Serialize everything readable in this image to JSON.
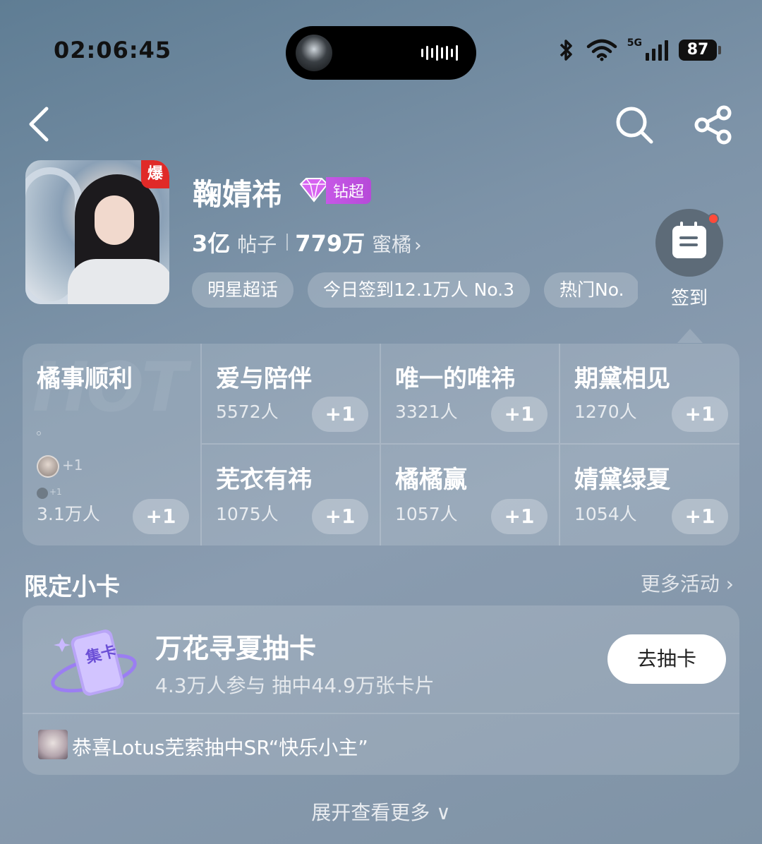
{
  "status_bar": {
    "time": "02:06:45",
    "network": "5G",
    "battery": "87"
  },
  "header": {
    "title": "鞠婧祎",
    "cover_badge": "爆",
    "vip_label": "钻超",
    "stats": [
      {
        "value": "3亿",
        "label": "帖子"
      },
      {
        "value": "779万",
        "label": "蜜橘"
      }
    ],
    "tags": [
      "明星超话",
      "今日签到12.1万人 No.3",
      "热门No."
    ],
    "checkin_label": "签到"
  },
  "grid": {
    "watermark": "HOT",
    "featured": {
      "name": "橘事顺利",
      "count": "3.1万人",
      "plus": "+1",
      "mini_plus": "+1",
      "mini_plus_small": "+1"
    },
    "cells": [
      {
        "name": "爱与陪伴",
        "count": "5572人",
        "plus": "+1"
      },
      {
        "name": "唯一的唯祎",
        "count": "3321人",
        "plus": "+1"
      },
      {
        "name": "期黛相见",
        "count": "1270人",
        "plus": "+1"
      },
      {
        "name": "芜衣有祎",
        "count": "1075人",
        "plus": "+1"
      },
      {
        "name": "橘橘赢",
        "count": "1057人",
        "plus": "+1"
      },
      {
        "name": "婧黛绿夏",
        "count": "1054人",
        "plus": "+1"
      }
    ]
  },
  "section": {
    "title": "限定小卡",
    "more": "更多活动 ›"
  },
  "card": {
    "icon_text": "集卡",
    "title": "万花寻夏抽卡",
    "subtitle": "4.3万人参与 抽中44.9万张卡片",
    "button": "去抽卡",
    "footer": "恭喜Lotus芜萦抽中SR“快乐小主”"
  },
  "expand_label": "展开查看更多 ∨"
}
